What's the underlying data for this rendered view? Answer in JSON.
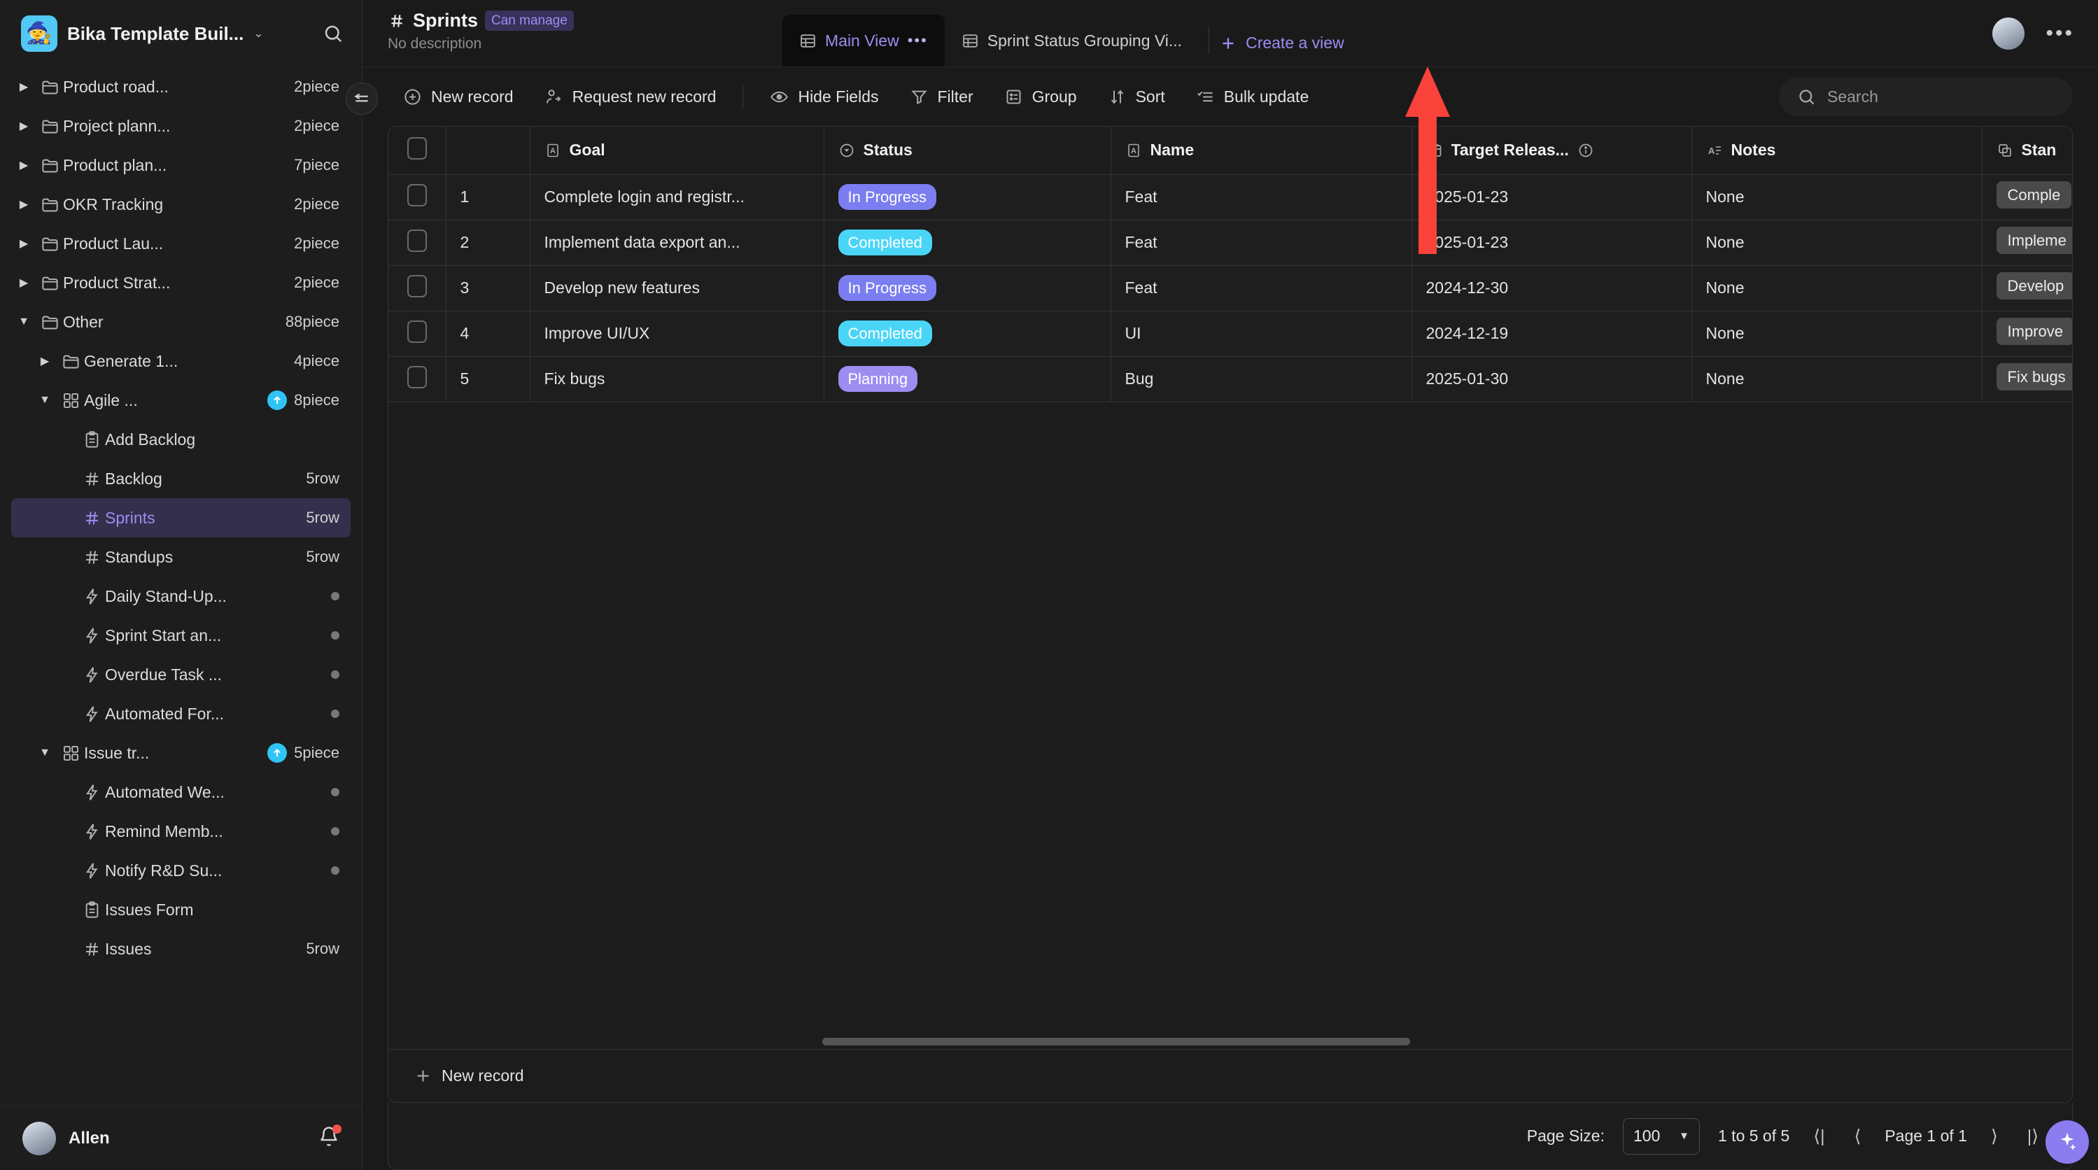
{
  "workspace": {
    "name": "Bika Template Buil...",
    "logo_emoji": "🧙",
    "caret": "⌄",
    "search_icon": "search-icon"
  },
  "sidebar": {
    "items": [
      {
        "label": "Product road...",
        "count": "2piece",
        "icon": "folder",
        "twisty": "collapsed",
        "indent": 1
      },
      {
        "label": "Project plann...",
        "count": "2piece",
        "icon": "folder",
        "twisty": "collapsed",
        "indent": 1
      },
      {
        "label": "Product plan...",
        "count": "7piece",
        "icon": "folder",
        "twisty": "collapsed",
        "indent": 1
      },
      {
        "label": "OKR Tracking",
        "count": "2piece",
        "icon": "folder",
        "twisty": "collapsed",
        "indent": 1
      },
      {
        "label": "Product Lau...",
        "count": "2piece",
        "icon": "folder",
        "twisty": "collapsed",
        "indent": 1
      },
      {
        "label": "Product Strat...",
        "count": "2piece",
        "icon": "folder",
        "twisty": "collapsed",
        "indent": 1
      },
      {
        "label": "Other",
        "count": "88piece",
        "icon": "folder",
        "twisty": "expanded",
        "indent": 1
      },
      {
        "label": "Generate 1...",
        "count": "4piece",
        "icon": "folder",
        "twisty": "collapsed",
        "indent": 2
      },
      {
        "label": "Agile ...",
        "count": "8piece",
        "icon": "grid",
        "twisty": "expanded",
        "indent": 2,
        "upgrade": true
      },
      {
        "label": "Add Backlog",
        "count": "",
        "icon": "form",
        "twisty": "none",
        "indent": 3
      },
      {
        "label": "Backlog",
        "count": "5row",
        "icon": "hash",
        "twisty": "none",
        "indent": 3
      },
      {
        "label": "Sprints",
        "count": "5row",
        "icon": "hash",
        "twisty": "none",
        "indent": 3,
        "selected": true
      },
      {
        "label": "Standups",
        "count": "5row",
        "icon": "hash",
        "twisty": "none",
        "indent": 3
      },
      {
        "label": "Daily Stand-Up...",
        "count": "",
        "icon": "bolt",
        "twisty": "none",
        "indent": 3,
        "dot": true
      },
      {
        "label": "Sprint Start an...",
        "count": "",
        "icon": "bolt",
        "twisty": "none",
        "indent": 3,
        "dot": true
      },
      {
        "label": "Overdue Task ...",
        "count": "",
        "icon": "bolt",
        "twisty": "none",
        "indent": 3,
        "dot": true
      },
      {
        "label": "Automated For...",
        "count": "",
        "icon": "bolt",
        "twisty": "none",
        "indent": 3,
        "dot": true
      },
      {
        "label": "Issue tr...",
        "count": "5piece",
        "icon": "grid",
        "twisty": "expanded",
        "indent": 2,
        "upgrade": true
      },
      {
        "label": "Automated We...",
        "count": "",
        "icon": "bolt",
        "twisty": "none",
        "indent": 3,
        "dot": true
      },
      {
        "label": "Remind Memb...",
        "count": "",
        "icon": "bolt",
        "twisty": "none",
        "indent": 3,
        "dot": true
      },
      {
        "label": "Notify R&D Su...",
        "count": "",
        "icon": "bolt",
        "twisty": "none",
        "indent": 3,
        "dot": true
      },
      {
        "label": "Issues Form",
        "count": "",
        "icon": "form",
        "twisty": "none",
        "indent": 3
      },
      {
        "label": "Issues",
        "count": "5row",
        "icon": "hash",
        "twisty": "none",
        "indent": 3
      }
    ],
    "user": {
      "name": "Allen",
      "avatar": "avatar",
      "bell": "bell-icon",
      "has_notification": true
    }
  },
  "header": {
    "table_title": "Sprints",
    "permission_badge": "Can manage",
    "description": "No description",
    "views": [
      {
        "label": "Main View",
        "active": true,
        "icon": "table-icon",
        "overflow": "•••"
      },
      {
        "label": "Sprint Status Grouping Vi...",
        "active": false,
        "icon": "table-icon"
      }
    ],
    "create_view": "Create a view",
    "more_menu": "•••"
  },
  "toolbar": {
    "new_record": "New record",
    "request_new_record": "Request new record",
    "hide_fields": "Hide Fields",
    "filter": "Filter",
    "group": "Group",
    "sort": "Sort",
    "bulk_update": "Bulk update"
  },
  "search": {
    "placeholder": "Search",
    "value": ""
  },
  "table": {
    "columns": [
      {
        "label": "Goal",
        "icon": "text-field-icon"
      },
      {
        "label": "Status",
        "icon": "select-field-icon"
      },
      {
        "label": "Name",
        "icon": "text-field-icon"
      },
      {
        "label": "Target Releas...",
        "icon": "date-field-icon",
        "info": "info-icon"
      },
      {
        "label": "Notes",
        "icon": "longtext-field-icon"
      },
      {
        "label": "Stan",
        "icon": "link-field-icon"
      }
    ],
    "rows": [
      {
        "index": "1",
        "goal": "Complete login and registr...",
        "status": "In Progress",
        "status_color": "#7b7ef0",
        "name": "Feat",
        "target_release": "2025-01-23",
        "notes": "None",
        "standard": "Comple"
      },
      {
        "index": "2",
        "goal": "Implement data export an...",
        "status": "Completed",
        "status_color": "#4ad5f7",
        "name": "Feat",
        "target_release": "2025-01-23",
        "notes": "None",
        "standard": "Impleme"
      },
      {
        "index": "3",
        "goal": "Develop new features",
        "status": "In Progress",
        "status_color": "#7b7ef0",
        "name": "Feat",
        "target_release": "2024-12-30",
        "notes": "None",
        "standard": "Develop"
      },
      {
        "index": "4",
        "goal": "Improve UI/UX",
        "status": "Completed",
        "status_color": "#4ad5f7",
        "name": "UI",
        "target_release": "2024-12-19",
        "notes": "None",
        "standard": "Improve"
      },
      {
        "index": "5",
        "goal": "Fix bugs",
        "status": "Planning",
        "status_color": "#9d8df1",
        "name": "Bug",
        "target_release": "2025-01-30",
        "notes": "None",
        "standard": "Fix bugs"
      }
    ],
    "footer_new_record": "New record"
  },
  "pagination": {
    "page_size_label": "Page Size:",
    "page_size_value": "100",
    "range": "1 to 5 of 5",
    "page_indicator": "Page 1 of 1",
    "first": "⟨|",
    "prev": "⟨",
    "next": "⟩",
    "last": "|⟩"
  },
  "colors": {
    "accent": "#8b7cf0",
    "selected_bg": "#342f4c",
    "annotation_arrow": "#f9423a"
  }
}
